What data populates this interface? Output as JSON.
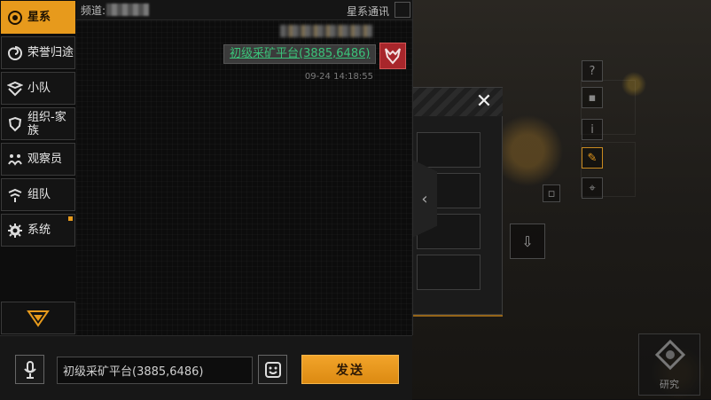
{
  "sidebar": {
    "items": [
      {
        "label": "星系",
        "icon": "galaxy-icon",
        "active": true
      },
      {
        "label": "荣誉归途",
        "icon": "spiral-icon",
        "active": false
      },
      {
        "label": "小队",
        "icon": "squad-icon",
        "active": false
      },
      {
        "label": "组织-家族",
        "icon": "shield-icon",
        "active": false
      },
      {
        "label": "观察员",
        "icon": "observer-icon",
        "active": false
      },
      {
        "label": "组队",
        "icon": "team-up-icon",
        "active": false
      },
      {
        "label": "系统",
        "icon": "gear-icon",
        "active": false,
        "notify": true
      }
    ],
    "expand_icon": "triangle-down-icon"
  },
  "chat": {
    "channel_label": "频道:",
    "header_title": "星系通讯",
    "message": {
      "text": "初级采矿平台(3885,6486)",
      "time": "09-24 14:18:55",
      "avatar_icon": "faction-emblem-icon"
    }
  },
  "input": {
    "value": "初级采矿平台(3885,6486)",
    "send_label": "发送",
    "voice_icon": "microphone-icon",
    "emoji_icon": "smiley-icon"
  },
  "overlay": {
    "close_icon": "close-icon",
    "collapse_glyph": "‹"
  },
  "right_icons": {
    "research_label": "研究"
  },
  "colors": {
    "accent": "#e79a1c",
    "link_green": "#3bc47a",
    "avatar_red": "#a8262b"
  }
}
